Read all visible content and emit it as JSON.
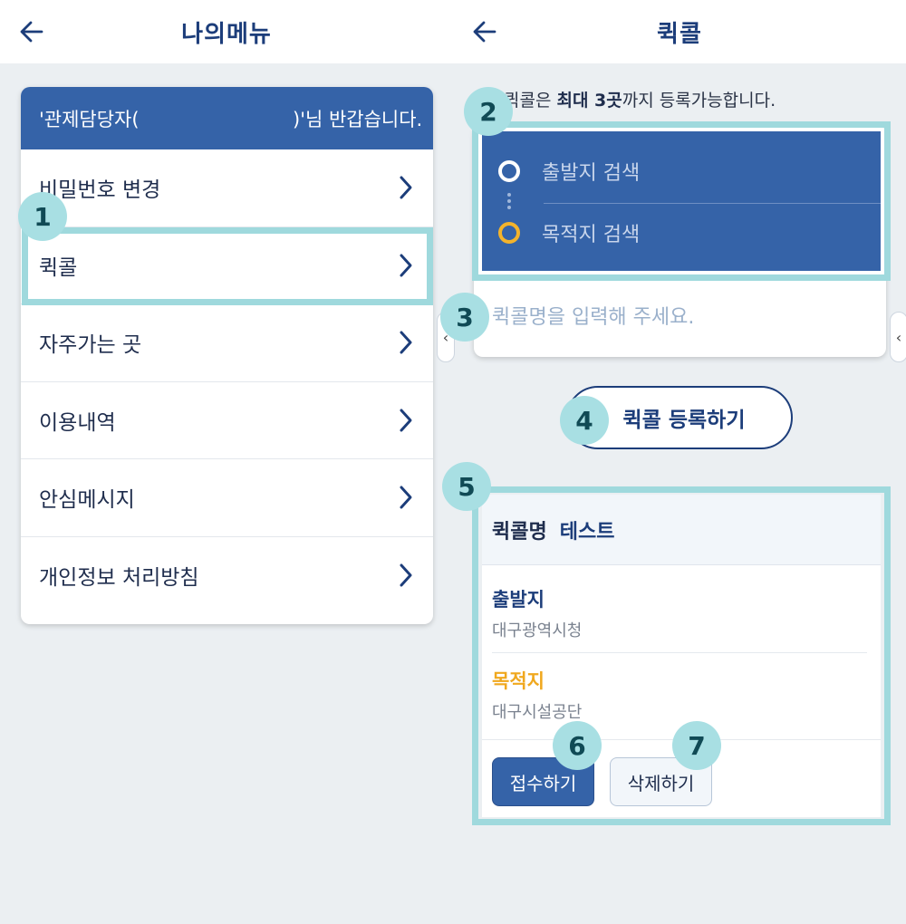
{
  "left_screen": {
    "header": {
      "title": "나의메뉴"
    },
    "greeting": {
      "prefix": "'관제담당자(",
      "suffix": ")'님 반갑습니다."
    },
    "menu_items": [
      {
        "label": "비밀번호 변경"
      },
      {
        "label": "퀵콜"
      },
      {
        "label": "자주가는 곳"
      },
      {
        "label": "이용내역"
      },
      {
        "label": "안심메시지"
      },
      {
        "label": "개인정보 처리방침"
      }
    ]
  },
  "right_screen": {
    "header": {
      "title": "퀵콜"
    },
    "notice": {
      "pre": "퀵콜은 ",
      "bold": "최대 3곳",
      "post": "까지 등록가능합니다."
    },
    "route": {
      "origin_placeholder": "출발지 검색",
      "destination_placeholder": "목적지 검색"
    },
    "name_input": {
      "placeholder": "퀵콜명을 입력해 주세요.",
      "value": ""
    },
    "register_button": "퀵콜 등록하기",
    "saved": {
      "name_label": "퀵콜명",
      "name_value": "테스트",
      "origin_label": "출발지",
      "origin_value": "대구광역시청",
      "destination_label": "목적지",
      "destination_value": "대구시설공단",
      "accept_button": "접수하기",
      "delete_button": "삭제하기"
    }
  },
  "side_tabs": {
    "left_glyph": "‹",
    "right_glyph": "‹"
  },
  "callouts": [
    "1",
    "2",
    "3",
    "4",
    "5",
    "6",
    "7"
  ],
  "colors": {
    "primary": "#3563a8",
    "navy": "#1c3d7a",
    "highlight": "#9fd9dd",
    "badge": "#a8dfe3",
    "accent_orange": "#f0a81e",
    "background": "#ebeff2"
  },
  "icons": {
    "back": "back-arrow-icon",
    "chevron": "chevron-right-icon"
  }
}
